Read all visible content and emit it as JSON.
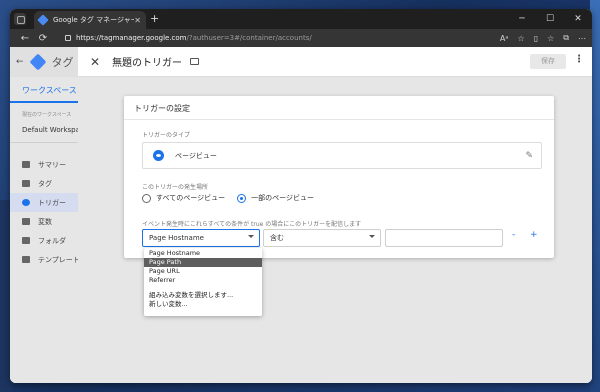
{
  "browser": {
    "tab_title": "Google タグ マネージャー",
    "url_domain": "https://tagmanager.google.com",
    "url_path": "/?authuser=3#/container/accounts/",
    "new_tab_glyph": "+",
    "window_controls": [
      "─",
      "☐",
      "✕"
    ]
  },
  "gtm": {
    "brand": "タグ",
    "workspace_tab": "ワークスペース",
    "current_workspace_label": "現在のワークスペース",
    "workspace_name": "Default Workspace",
    "nav": [
      {
        "label": "サマリー",
        "icon": "folder-icon"
      },
      {
        "label": "タグ",
        "icon": "tag-icon"
      },
      {
        "label": "トリガー",
        "icon": "trigger-icon",
        "active": true
      },
      {
        "label": "変数",
        "icon": "variable-icon"
      },
      {
        "label": "フォルダ",
        "icon": "folder-icon"
      },
      {
        "label": "テンプレート",
        "icon": "template-icon"
      }
    ]
  },
  "panel": {
    "title": "無題のトリガー",
    "save_label": "保存"
  },
  "trigger": {
    "card_title": "トリガーの設定",
    "type_label": "トリガーのタイプ",
    "type_name": "ページビュー",
    "fires_on_label": "このトリガーの発生場所",
    "option_all": "すべてのページビュー",
    "option_some": "一部のページビュー",
    "condition_label": "イベント発生時にこれらすべての条件が true の場合にこのトリガーを配信します",
    "variable_value": "Page Hostname",
    "operator_value": "含む",
    "value_input": "",
    "minus_label": "-",
    "plus_label": "+"
  },
  "dropdown": {
    "items": [
      "Page Hostname",
      "Page Path",
      "Page URL",
      "Referrer"
    ],
    "highlighted_index": 1,
    "builtin_label": "組み込み変数を選択します...",
    "new_variable_label": "新しい変数..."
  },
  "colors": {
    "accent": "#1a73e8",
    "highlight": "#5e5e5e"
  }
}
